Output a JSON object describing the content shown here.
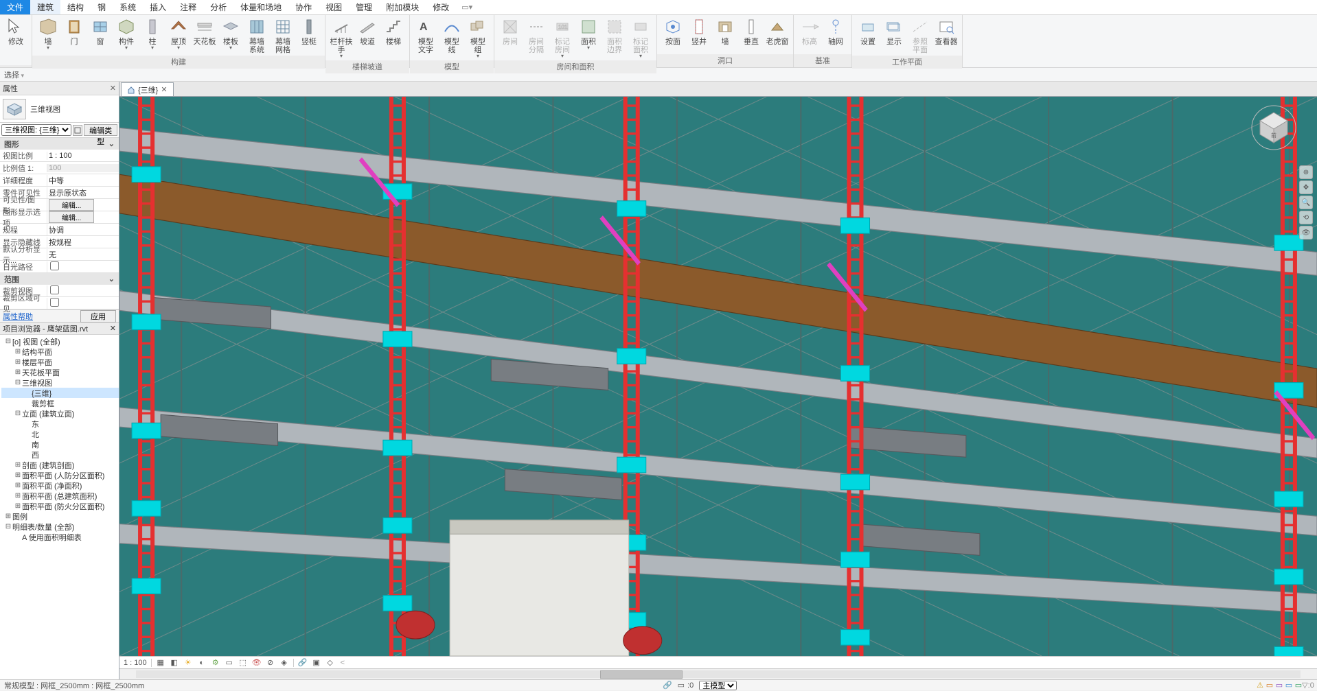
{
  "menu": {
    "file": "文件",
    "items": [
      "建筑",
      "结构",
      "钢",
      "系统",
      "插入",
      "注释",
      "分析",
      "体量和场地",
      "协作",
      "视图",
      "管理",
      "附加模块",
      "修改"
    ],
    "active": "建筑"
  },
  "selectbar": {
    "label": "选择"
  },
  "ribbon": {
    "groups": [
      {
        "title": "",
        "buttons": [
          {
            "k": "modify",
            "label": "修改",
            "icon": "cursor"
          }
        ]
      },
      {
        "title": "构建",
        "buttons": [
          {
            "k": "wall",
            "label": "墙",
            "icon": "wall",
            "drop": true
          },
          {
            "k": "door",
            "label": "门",
            "icon": "door"
          },
          {
            "k": "window",
            "label": "窗",
            "icon": "window"
          },
          {
            "k": "component",
            "label": "构件",
            "icon": "component",
            "drop": true
          },
          {
            "k": "column",
            "label": "柱",
            "icon": "column",
            "drop": true
          },
          {
            "k": "roof",
            "label": "屋顶",
            "icon": "roof",
            "drop": true
          },
          {
            "k": "ceiling",
            "label": "天花板",
            "icon": "ceiling"
          },
          {
            "k": "floor",
            "label": "楼板",
            "icon": "floor",
            "drop": true
          },
          {
            "k": "curtainsys",
            "label": "幕墙\n系统",
            "icon": "curtainsys"
          },
          {
            "k": "curtaingrid",
            "label": "幕墙\n网格",
            "icon": "curtaingrid"
          },
          {
            "k": "mullion",
            "label": "竖梃",
            "icon": "mullion"
          }
        ]
      },
      {
        "title": "楼梯坡道",
        "buttons": [
          {
            "k": "railing",
            "label": "栏杆扶手",
            "icon": "railing",
            "drop": true
          },
          {
            "k": "ramp",
            "label": "坡道",
            "icon": "ramp"
          },
          {
            "k": "stair",
            "label": "楼梯",
            "icon": "stair"
          }
        ]
      },
      {
        "title": "模型",
        "buttons": [
          {
            "k": "modeltext",
            "label": "模型\n文字",
            "icon": "mtext"
          },
          {
            "k": "modelline",
            "label": "模型\n线",
            "icon": "mline"
          },
          {
            "k": "modelgroup",
            "label": "模型\n组",
            "icon": "mgroup",
            "drop": true
          }
        ]
      },
      {
        "title": "房间和面积",
        "buttons": [
          {
            "k": "room",
            "label": "房间",
            "icon": "room",
            "disabled": true
          },
          {
            "k": "roomsep",
            "label": "房间\n分隔",
            "icon": "roomsep",
            "disabled": true
          },
          {
            "k": "tagroom",
            "label": "标记\n房间",
            "icon": "tagroom",
            "drop": true,
            "disabled": true
          },
          {
            "k": "area",
            "label": "面积",
            "icon": "area",
            "drop": true
          },
          {
            "k": "areabnd",
            "label": "面积\n边界",
            "icon": "areabnd",
            "disabled": true
          },
          {
            "k": "tagarea",
            "label": "标记\n面积",
            "icon": "tagarea",
            "drop": true,
            "disabled": true
          }
        ]
      },
      {
        "title": "",
        "buttons": [
          {
            "k": "byface",
            "label": "按面",
            "icon": "byface"
          },
          {
            "k": "shaft",
            "label": "竖井",
            "icon": "shaft"
          },
          {
            "k": "owall",
            "label": "墙",
            "icon": "owall"
          },
          {
            "k": "vert",
            "label": "垂直",
            "icon": "vert"
          },
          {
            "k": "dormer",
            "label": "老虎窗",
            "icon": "dormer"
          }
        ],
        "etitle": "洞口"
      },
      {
        "title": "基准",
        "buttons": [
          {
            "k": "level",
            "label": "标高",
            "icon": "level",
            "disabled": true
          },
          {
            "k": "grid",
            "label": "轴网",
            "icon": "grid"
          }
        ]
      },
      {
        "title": "工作平面",
        "buttons": [
          {
            "k": "set",
            "label": "设置",
            "icon": "set"
          },
          {
            "k": "show",
            "label": "显示",
            "icon": "show"
          },
          {
            "k": "refplane",
            "label": "参照\n平面",
            "icon": "refplane",
            "disabled": true
          },
          {
            "k": "viewer",
            "label": "查看器",
            "icon": "viewer"
          }
        ]
      }
    ]
  },
  "tabs": {
    "hometip": "",
    "current": "{三维}"
  },
  "properties": {
    "title": "属性",
    "type": "三维视图",
    "selector": "三维视图: {三维}",
    "editType": "编辑类型",
    "cats": [
      {
        "name": "图形",
        "rows": [
          {
            "k": "视图比例",
            "v": "1 : 100"
          },
          {
            "k": "比例值 1:",
            "v": "100",
            "ro": true
          },
          {
            "k": "详细程度",
            "v": "中等"
          },
          {
            "k": "零件可见性",
            "v": "显示原状态"
          },
          {
            "k": "可见性/图形...",
            "btn": "编辑..."
          },
          {
            "k": "图形显示选项",
            "btn": "编辑..."
          },
          {
            "k": "规程",
            "v": "协调"
          },
          {
            "k": "显示隐藏线",
            "v": "按规程"
          },
          {
            "k": "默认分析显示...",
            "v": "无"
          },
          {
            "k": "日光路径",
            "chk": false
          }
        ]
      },
      {
        "name": "范围",
        "rows": [
          {
            "k": "裁剪视图",
            "chk": false
          },
          {
            "k": "裁剪区域可见",
            "chk": false
          }
        ]
      }
    ],
    "help": "属性帮助",
    "apply": "应用"
  },
  "browser": {
    "title": "项目浏览器 - 鹰架蓝图.rvt",
    "tree": [
      {
        "d": 0,
        "tw": "-",
        "icon": "root",
        "label": "[o] 视图 (全部)"
      },
      {
        "d": 1,
        "tw": "+",
        "label": "结构平面"
      },
      {
        "d": 1,
        "tw": "+",
        "label": "楼层平面"
      },
      {
        "d": 1,
        "tw": "+",
        "label": "天花板平面"
      },
      {
        "d": 1,
        "tw": "-",
        "label": "三维视图"
      },
      {
        "d": 2,
        "tw": "",
        "label": "{三维}",
        "sel": true
      },
      {
        "d": 2,
        "tw": "",
        "label": "裁剪框"
      },
      {
        "d": 1,
        "tw": "-",
        "label": "立面 (建筑立面)"
      },
      {
        "d": 2,
        "tw": "",
        "label": "东"
      },
      {
        "d": 2,
        "tw": "",
        "label": "北"
      },
      {
        "d": 2,
        "tw": "",
        "label": "南"
      },
      {
        "d": 2,
        "tw": "",
        "label": "西"
      },
      {
        "d": 1,
        "tw": "+",
        "label": "剖面 (建筑剖面)"
      },
      {
        "d": 1,
        "tw": "+",
        "label": "面积平面 (人防分区面积)"
      },
      {
        "d": 1,
        "tw": "+",
        "label": "面积平面 (净面积)"
      },
      {
        "d": 1,
        "tw": "+",
        "label": "面积平面 (总建筑面积)"
      },
      {
        "d": 1,
        "tw": "+",
        "label": "面积平面 (防火分区面积)"
      },
      {
        "d": 0,
        "tw": "+",
        "icon": "leg",
        "label": "图例"
      },
      {
        "d": 0,
        "tw": "-",
        "icon": "sch",
        "label": "明细表/数量 (全部)"
      },
      {
        "d": 1,
        "tw": "",
        "label": "A 使用面积明细表"
      }
    ]
  },
  "viewctrl": {
    "scale": "1 : 100",
    "icons": [
      "graph",
      "sun",
      "shadow",
      "crop",
      "cropvis",
      "hide",
      "reveal",
      "constr",
      "sect",
      "link",
      "temp",
      "box"
    ]
  },
  "status": {
    "msg": "常规模型 : 网框_2500mm : 网框_2500mm",
    "zero": ":0",
    "model": "主模型",
    "ricons": [
      "warn",
      "sel1",
      "sel2",
      "sel3",
      "sel4",
      "filter"
    ],
    "rzero": ":0"
  },
  "colors": {
    "accent": "#1e88e5",
    "red": "#e53030",
    "cyan": "#00d8e0",
    "brown": "#8b5a2b",
    "teal": "#2c7c7c",
    "steel": "#9aa3ab"
  }
}
